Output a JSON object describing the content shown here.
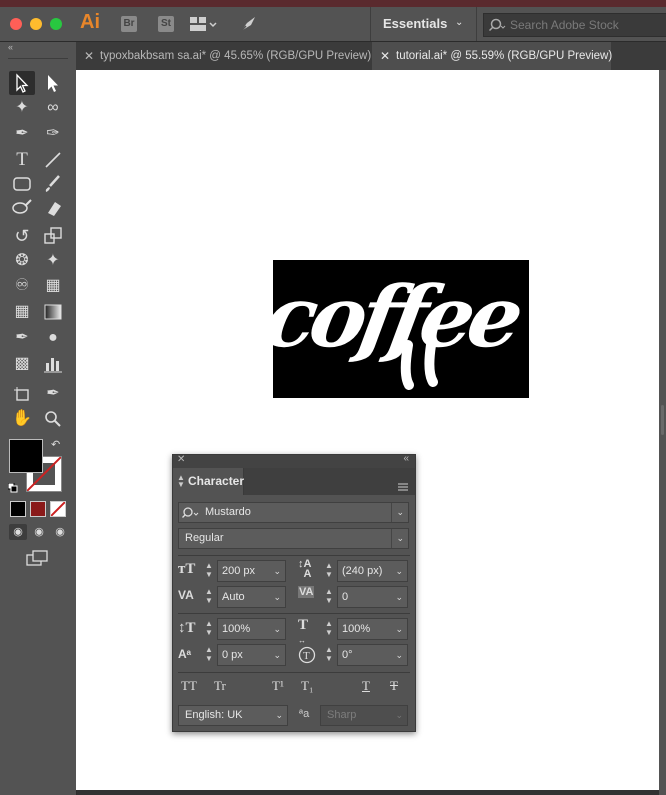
{
  "app": {
    "logo": "Ai",
    "bridge": "Br",
    "stock": "St",
    "workspace": "Essentials",
    "search_placeholder": "Search Adobe Stock"
  },
  "tabs": [
    {
      "label": "typoxbakbsam sa.ai* @ 45.65% (RGB/GPU Preview)",
      "active": false
    },
    {
      "label": "tutorial.ai* @ 55.59% (RGB/GPU Preview)",
      "active": true
    }
  ],
  "artwork": {
    "text": "coffee"
  },
  "character_panel": {
    "title": "Character",
    "font_family": "Mustardo",
    "font_style": "Regular",
    "font_size": "200 px",
    "leading": "(240 px)",
    "kerning": "Auto",
    "tracking": "0",
    "vertical_scale": "100%",
    "horizontal_scale": "100%",
    "baseline_shift": "0 px",
    "rotation": "0°",
    "language": "English: UK",
    "antialias": "Sharp",
    "style_buttons": [
      "TT",
      "Tr",
      "T¹",
      "T₁",
      "T",
      "T"
    ],
    "aa_label": "ªa"
  },
  "colors": {
    "accent": "#e8862a",
    "fill": "#000000",
    "stroke_none": "#cc2222"
  }
}
